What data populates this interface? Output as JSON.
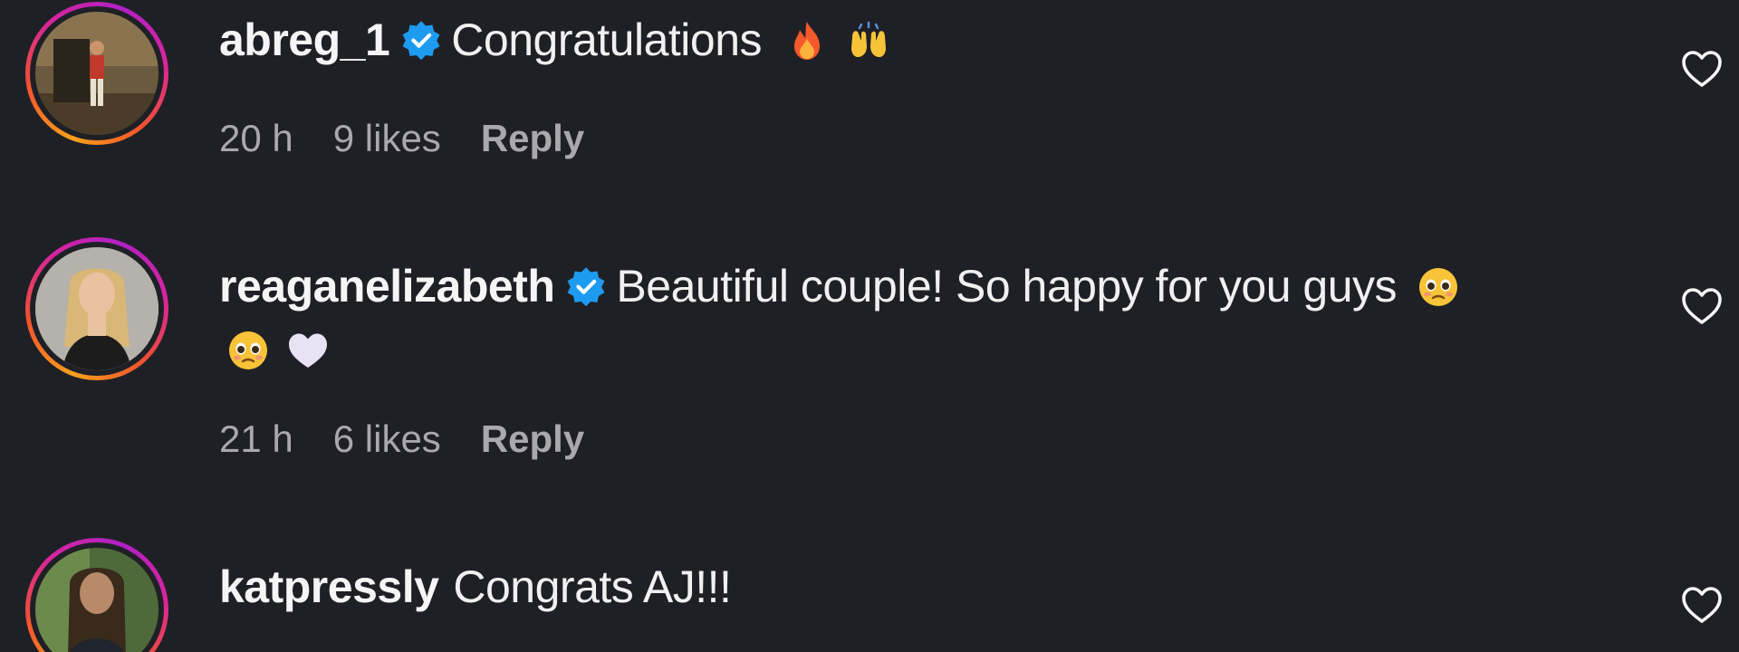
{
  "comments": [
    {
      "username": "abreg_1",
      "verified": true,
      "text": "Congratulations",
      "emojis": [
        "fire-emoji",
        "raising-hands-emoji"
      ],
      "time": "20 h",
      "likes": "9 likes",
      "reply_label": "Reply"
    },
    {
      "username": "reaganelizabeth",
      "verified": true,
      "text": "Beautiful couple! So happy for you guys",
      "emojis": [
        "pleading-face-emoji",
        "pleading-face-emoji",
        "white-heart-emoji"
      ],
      "time": "21 h",
      "likes": "6 likes",
      "reply_label": "Reply"
    },
    {
      "username": "katpressly",
      "verified": false,
      "text": "Congrats AJ!!!",
      "emojis": []
    }
  ],
  "colors": {
    "background": "#1f2026",
    "text": "#f5f5f5",
    "meta": "#a8a8ad",
    "verified": "#1d9bf0"
  }
}
